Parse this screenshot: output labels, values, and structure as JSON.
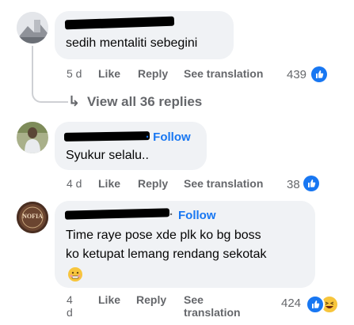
{
  "comments": [
    {
      "text": "sedih mentaliti sebegini",
      "follow_label": "",
      "time": "5 d",
      "like_label": "Like",
      "reply_label": "Reply",
      "translation_label": "See translation",
      "reaction_count": "439"
    },
    {
      "text": "Syukur selalu..",
      "follow_label": "Follow",
      "time": "4 d",
      "like_label": "Like",
      "reply_label": "Reply",
      "translation_label": "See translation",
      "reaction_count": "38"
    },
    {
      "text_line1": "Time raye pose xde plk ko bg boss",
      "text_line2": "ko ketupat lemang rendang sekotak",
      "follow_label": "Follow",
      "time_line1": "4",
      "time_line2": "d",
      "like_label": "Like",
      "reply_label": "Reply",
      "translation_line1": "See",
      "translation_line2": "translation",
      "reaction_count": "424"
    }
  ],
  "view_replies_label": "View all 36 replies",
  "avatar3_text": "NOFIA",
  "colors": {
    "like_blue": "#1877f2",
    "link_blue": "#1877f2",
    "meta_gray": "#65676b",
    "bubble": "#f0f2f5"
  }
}
